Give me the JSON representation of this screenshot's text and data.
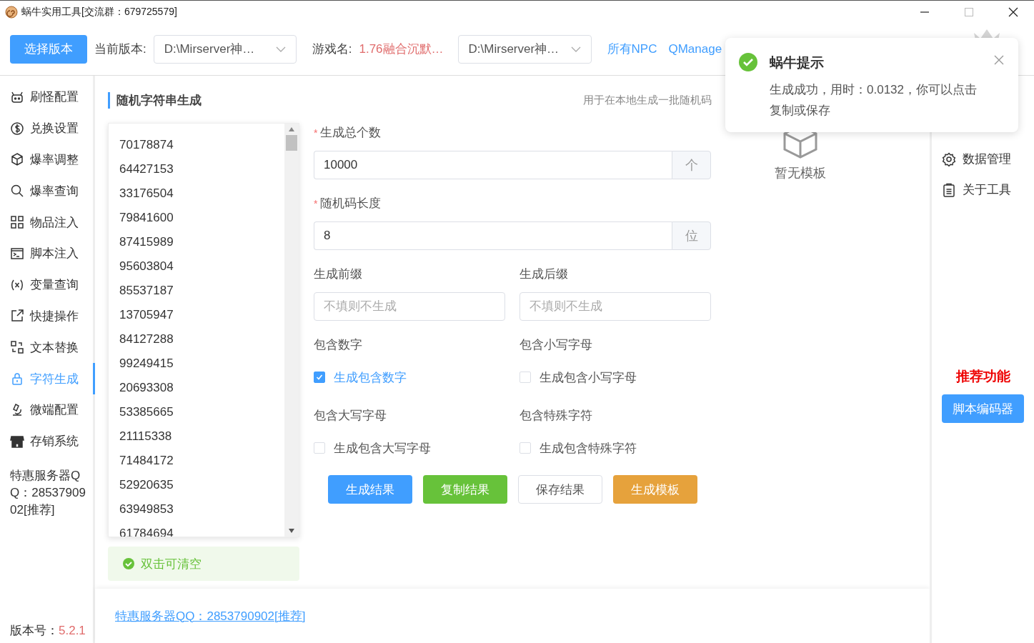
{
  "window": {
    "title": "蜗牛实用工具[交流群：679725579]"
  },
  "toolbar": {
    "choose_button": "选择版本",
    "version_label": "当前版本:",
    "version_select": "D:\\Mirserver神…",
    "game_label": "游戏名:",
    "game_name": "1.76融合沉默…",
    "path_select": "D:\\Mirserver神…",
    "links": [
      "所有NPC",
      "QManage"
    ]
  },
  "sidebar": {
    "items": [
      {
        "label": "刷怪配置",
        "selected": false
      },
      {
        "label": "兑换设置",
        "selected": false
      },
      {
        "label": "爆率调整",
        "selected": false
      },
      {
        "label": "爆率查询",
        "selected": false
      },
      {
        "label": "物品注入",
        "selected": false
      },
      {
        "label": "脚本注入",
        "selected": false
      },
      {
        "label": "变量查询",
        "selected": false
      },
      {
        "label": "快捷操作",
        "selected": false
      },
      {
        "label": "文本替换",
        "selected": false
      },
      {
        "label": "字符生成",
        "selected": true
      },
      {
        "label": "微端配置",
        "selected": false
      },
      {
        "label": "存销系统",
        "selected": false
      }
    ],
    "promo": "特惠服务器QQ：2853790902[推荐]",
    "version_label": "版本号：",
    "version": "5.2.1"
  },
  "panel": {
    "title": "随机字符串生成",
    "subtitle": "用于在本地生成一批随机码",
    "results": [
      "70178874",
      "64427153",
      "33176504",
      "79841600",
      "87415989",
      "95603804",
      "85537187",
      "13705947",
      "84127288",
      "99249415",
      "20693308",
      "53385665",
      "21115338",
      "71484172",
      "52920635",
      "63949853",
      "61784694"
    ],
    "hint": "双击可清空",
    "fields": [
      {
        "label": "生成总个数",
        "required_mark": "*",
        "value": "10000",
        "addon": "个"
      },
      {
        "label": "随机码长度",
        "required_mark": "*",
        "value": "8",
        "addon": "位"
      }
    ],
    "affixes": [
      {
        "label": "生成前缀",
        "placeholder": "不填则不生成"
      },
      {
        "label": "生成后缀",
        "placeholder": "不填则不生成"
      }
    ],
    "options": [
      {
        "label": "包含数字",
        "text": "生成包含数字",
        "checked": true
      },
      {
        "label": "包含小写字母",
        "text": "生成包含小写字母",
        "checked": false
      },
      {
        "label": "包含大写字母",
        "text": "生成包含大写字母",
        "checked": false
      },
      {
        "label": "包含特殊字符",
        "text": "生成包含特殊字符",
        "checked": false
      }
    ],
    "buttons": [
      {
        "label": "生成结果",
        "kind": "primary"
      },
      {
        "label": "复制结果",
        "kind": "success"
      },
      {
        "label": "保存结果",
        "kind": "default"
      },
      {
        "label": "生成模板",
        "kind": "warning"
      }
    ],
    "templates_empty": "暂无模板"
  },
  "footer_link": "特惠服务器QQ：2853790902[推荐]",
  "right_panel": {
    "items": [
      {
        "label": "数据管理"
      },
      {
        "label": "关于工具"
      }
    ],
    "recommend_title": "推荐功能",
    "recommend_button": "脚本编码器"
  },
  "notification": {
    "title": "蜗牛提示",
    "message": "生成成功，用时：0.0132，你可以点击复制或保存"
  }
}
